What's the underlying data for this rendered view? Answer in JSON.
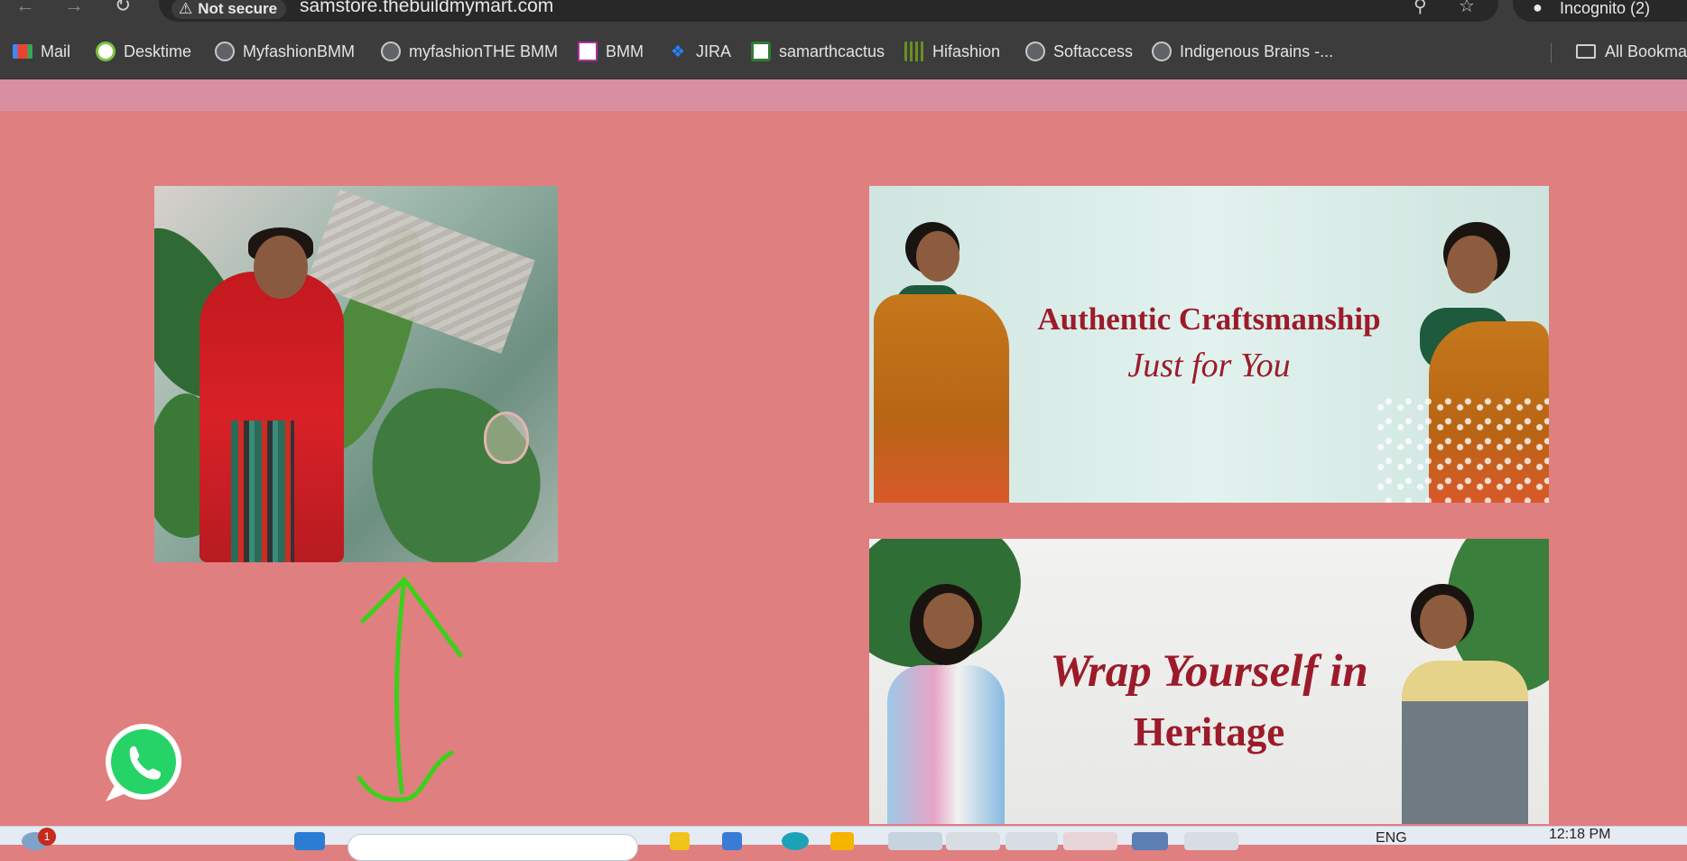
{
  "browser": {
    "security_label": "Not secure",
    "url": "samstore.thebuildmymart.com",
    "profile_label": "Incognito (2)",
    "bookmarks": [
      {
        "label": "Mail"
      },
      {
        "label": "Desktime"
      },
      {
        "label": "MyfashionBMM"
      },
      {
        "label": "myfashionTHE BMM"
      },
      {
        "label": "BMM"
      },
      {
        "label": "JIRA"
      },
      {
        "label": "samarthcactus"
      },
      {
        "label": "Hifashion"
      },
      {
        "label": "Softaccess"
      },
      {
        "label": "Indigenous Brains -..."
      }
    ],
    "all_bookmarks_label": "All Bookma"
  },
  "page": {
    "background_color": "#e07f80",
    "strip_color": "#d98ea2",
    "banner_1": {
      "line_1": "Authentic Craftsmanship",
      "line_2": "Just for You"
    },
    "banner_2": {
      "line_1": "Wrap Yourself in",
      "line_2": "Heritage"
    },
    "text_color": "#9c1b2a"
  },
  "taskbar": {
    "notification_count": "1",
    "language": "ENG",
    "time": "12:18 PM"
  }
}
